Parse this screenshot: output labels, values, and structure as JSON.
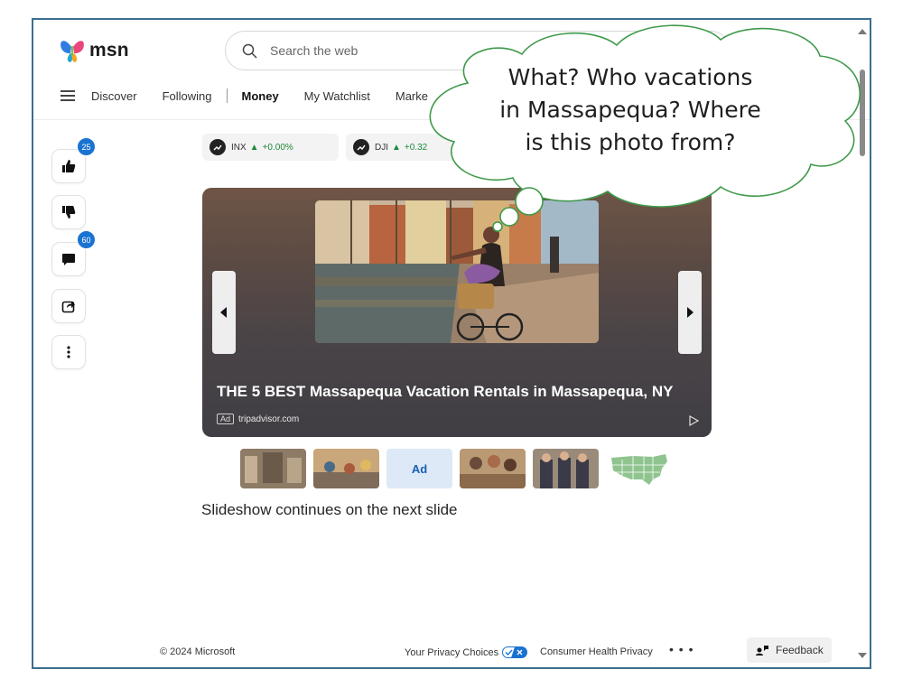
{
  "header": {
    "brand": "msn",
    "search_placeholder": "Search the web"
  },
  "nav": {
    "items": [
      "Discover",
      "Following",
      "Money",
      "My Watchlist",
      "Marke"
    ],
    "active": "Money"
  },
  "rail": {
    "like_count": "25",
    "comment_count": "60"
  },
  "tickers": [
    {
      "symbol": "INX",
      "change": "+0.00%"
    },
    {
      "symbol": "DJI",
      "change": "+0.32"
    }
  ],
  "slide": {
    "title": "THE 5 BEST Massapequa Vacation Rentals in Massapequa, NY",
    "ad_label": "Ad",
    "source": "tripadvisor.com"
  },
  "thumbnails": {
    "ad_label": "Ad"
  },
  "continues_text": "Slideshow continues on the next slide",
  "footer": {
    "copyright": "© 2024 Microsoft",
    "privacy": "Your Privacy Choices",
    "consumer": "Consumer Health Privacy",
    "more": "• • •",
    "feedback": "Feedback"
  },
  "annotation": {
    "line1": "What? Who vacations",
    "line2": "in Massapequa? Where",
    "line3": "is this photo from?"
  },
  "colors": {
    "frame_border": "#3a6f8f",
    "bubble_fill": "#ffffff",
    "bubble_stroke": "#3f9a4a",
    "badge": "#1a73d1"
  }
}
